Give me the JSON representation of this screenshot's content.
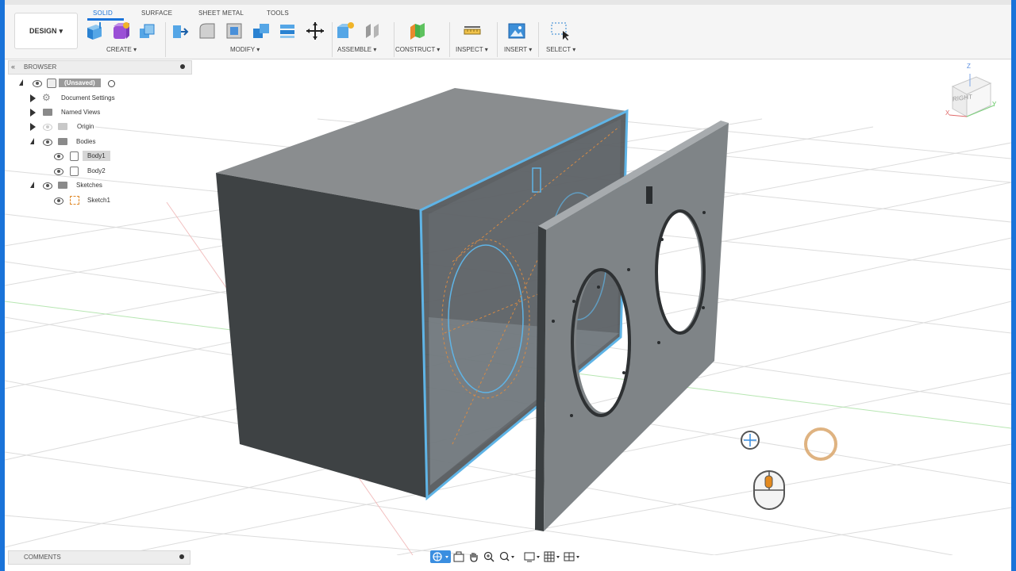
{
  "workspace": {
    "label": "DESIGN"
  },
  "tabs": [
    {
      "label": "SOLID",
      "active": true
    },
    {
      "label": "SURFACE",
      "active": false
    },
    {
      "label": "SHEET METAL",
      "active": false
    },
    {
      "label": "TOOLS",
      "active": false
    }
  ],
  "groups": {
    "create": "CREATE",
    "modify": "MODIFY",
    "assemble": "ASSEMBLE",
    "construct": "CONSTRUCT",
    "inspect": "INSPECT",
    "insert": "INSERT",
    "select": "SELECT"
  },
  "browser": {
    "title": "BROWSER",
    "root": "(Unsaved)",
    "items": {
      "document_settings": "Document Settings",
      "named_views": "Named Views",
      "origin": "Origin",
      "bodies": "Bodies",
      "body1": "Body1",
      "body2": "Body2",
      "sketches": "Sketches",
      "sketch1": "Sketch1"
    }
  },
  "viewcube": {
    "face": "RIGHT",
    "axis_x": "X",
    "axis_y": "Y",
    "axis_z": "Z"
  },
  "comments": {
    "title": "COMMENTS"
  },
  "colors": {
    "accent": "#1a73d9",
    "body": "#5a5d5f",
    "highlight": "#5fb4e6"
  }
}
